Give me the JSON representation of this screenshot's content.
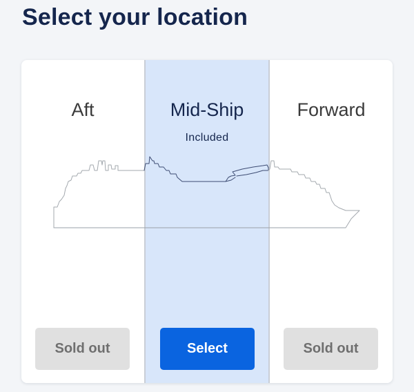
{
  "header": {
    "title": "Select your location"
  },
  "locations": [
    {
      "label": "Aft",
      "sub": "",
      "button": "Sold out",
      "state": "sold-out"
    },
    {
      "label": "Mid-Ship",
      "sub": "Included",
      "button": "Select",
      "state": "selected"
    },
    {
      "label": "Forward",
      "sub": "",
      "button": "Sold out",
      "state": "sold-out"
    }
  ],
  "colors": {
    "title": "#15264d",
    "selected_background": "#d8e6fa",
    "primary_button": "#0a64e0",
    "disabled_button": "#e0e0e0",
    "disabled_text": "#6f6f6f"
  },
  "icons": {
    "ship": "cruise-ship-outline-icon"
  }
}
